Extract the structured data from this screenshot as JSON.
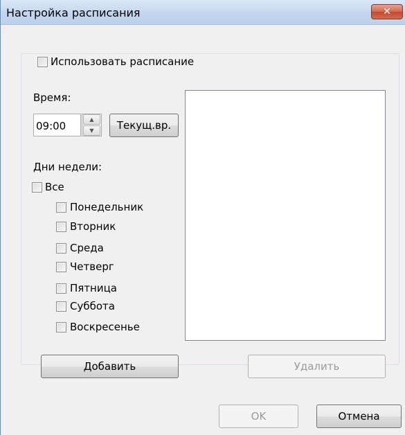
{
  "window": {
    "title": "Настройка расписания",
    "close_glyph": "✕"
  },
  "use_schedule": {
    "label": "Использовать расписание",
    "checked": false
  },
  "time": {
    "label": "Время:",
    "value": "09:00",
    "current_button": "Текущ.вр."
  },
  "weekdays": {
    "label": "Дни недели:",
    "all_label": "Все",
    "days": [
      "Понедельник",
      "Вторник",
      "Среда",
      "Четверг",
      "Пятница",
      "Суббота",
      "Воскресенье"
    ]
  },
  "schedule_list": {
    "items": []
  },
  "buttons": {
    "add": "Добавить",
    "delete": "Удалить",
    "ok": "OK",
    "cancel": "Отмена"
  },
  "icons": {
    "spin_up": "▲",
    "spin_down": "▼"
  }
}
